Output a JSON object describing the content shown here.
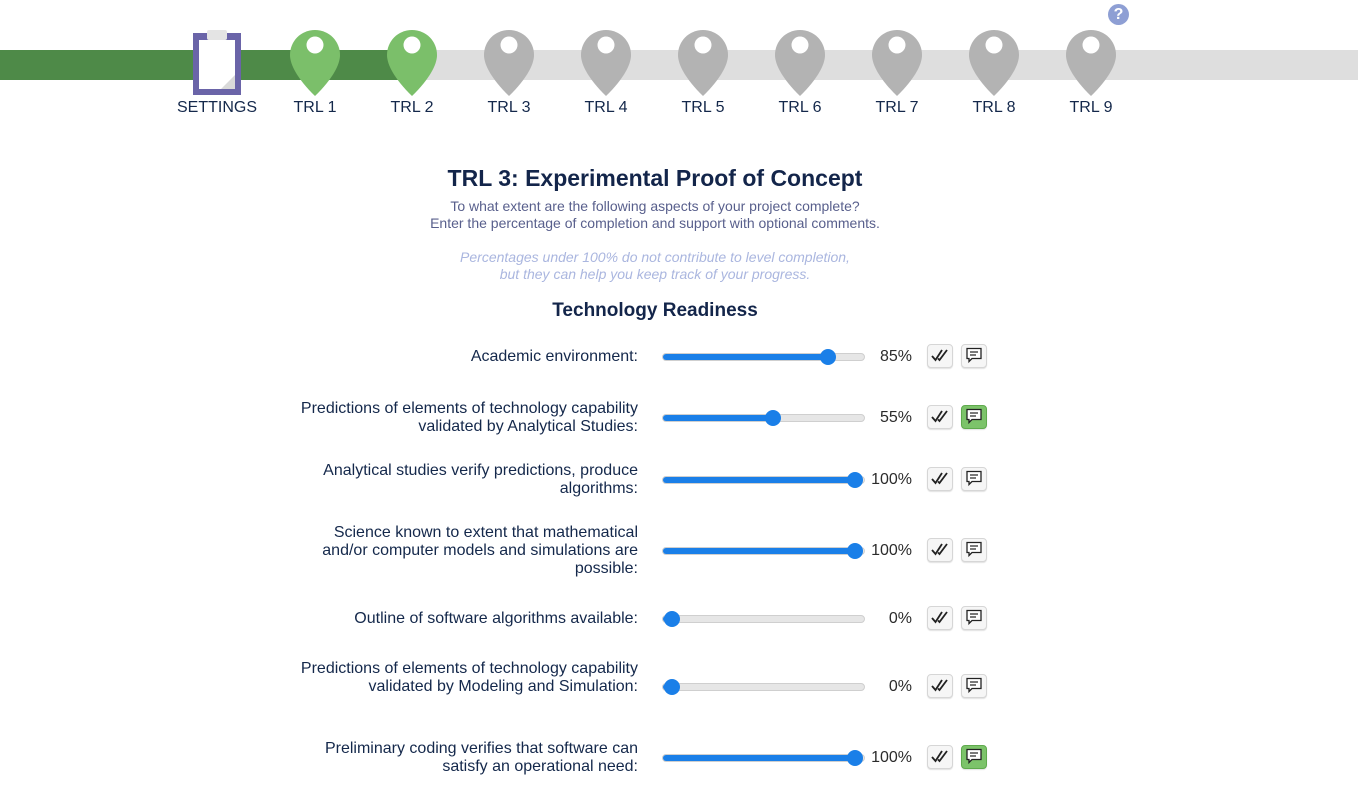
{
  "help": {
    "glyph": "?"
  },
  "steps": [
    {
      "label": "SETTINGS",
      "state": "settings"
    },
    {
      "label": "TRL 1",
      "state": "done"
    },
    {
      "label": "TRL 2",
      "state": "done"
    },
    {
      "label": "TRL 3",
      "state": "current"
    },
    {
      "label": "TRL 4",
      "state": "todo"
    },
    {
      "label": "TRL 5",
      "state": "todo"
    },
    {
      "label": "TRL 6",
      "state": "todo"
    },
    {
      "label": "TRL 7",
      "state": "todo"
    },
    {
      "label": "TRL 8",
      "state": "todo"
    },
    {
      "label": "TRL 9",
      "state": "todo"
    }
  ],
  "header": {
    "title": "TRL 3: Experimental Proof of Concept",
    "subtitle_line1": "To what extent are the following aspects of your project complete?",
    "subtitle_line2": "Enter the percentage of completion and support with optional comments.",
    "note_line1": "Percentages under 100% do not contribute to level completion,",
    "note_line2": "but they can help you keep track of your progress."
  },
  "section": {
    "title": "Technology Readiness"
  },
  "rows": [
    {
      "label": "Academic environment:",
      "value": 85,
      "value_text": "85%",
      "comment_active": false
    },
    {
      "label": "Predictions of elements of technology capability validated by Analytical Studies:",
      "value": 55,
      "value_text": "55%",
      "comment_active": true
    },
    {
      "label": "Analytical studies verify predictions, produce algorithms:",
      "value": 100,
      "value_text": "100%",
      "comment_active": false
    },
    {
      "label": "Science known to extent that mathematical and/or computer models and simulations are possible:",
      "value": 100,
      "value_text": "100%",
      "comment_active": false
    },
    {
      "label": "Outline of software algorithms available:",
      "value": 0,
      "value_text": "0%",
      "comment_active": false
    },
    {
      "label": "Predictions of elements of technology capability validated by Modeling and Simulation:",
      "value": 0,
      "value_text": "0%",
      "comment_active": false
    },
    {
      "label": "Preliminary coding verifies that software can satisfy an operational need:",
      "value": 100,
      "value_text": "100%",
      "comment_active": true
    }
  ],
  "colors": {
    "track_done": "#4e8a48",
    "track_todo": "#dedede",
    "pin_done": "#7bbf6a",
    "pin_todo": "#b3b3b3",
    "slider_accent": "#1a7fe8",
    "comment_active": "#7cc36a",
    "settings_icon": "#6a64a8"
  },
  "icons": {
    "settings": "clipboard-icon",
    "step": "map-pin-icon",
    "check": "double-check-icon",
    "comment": "comment-icon",
    "help": "help-icon"
  }
}
